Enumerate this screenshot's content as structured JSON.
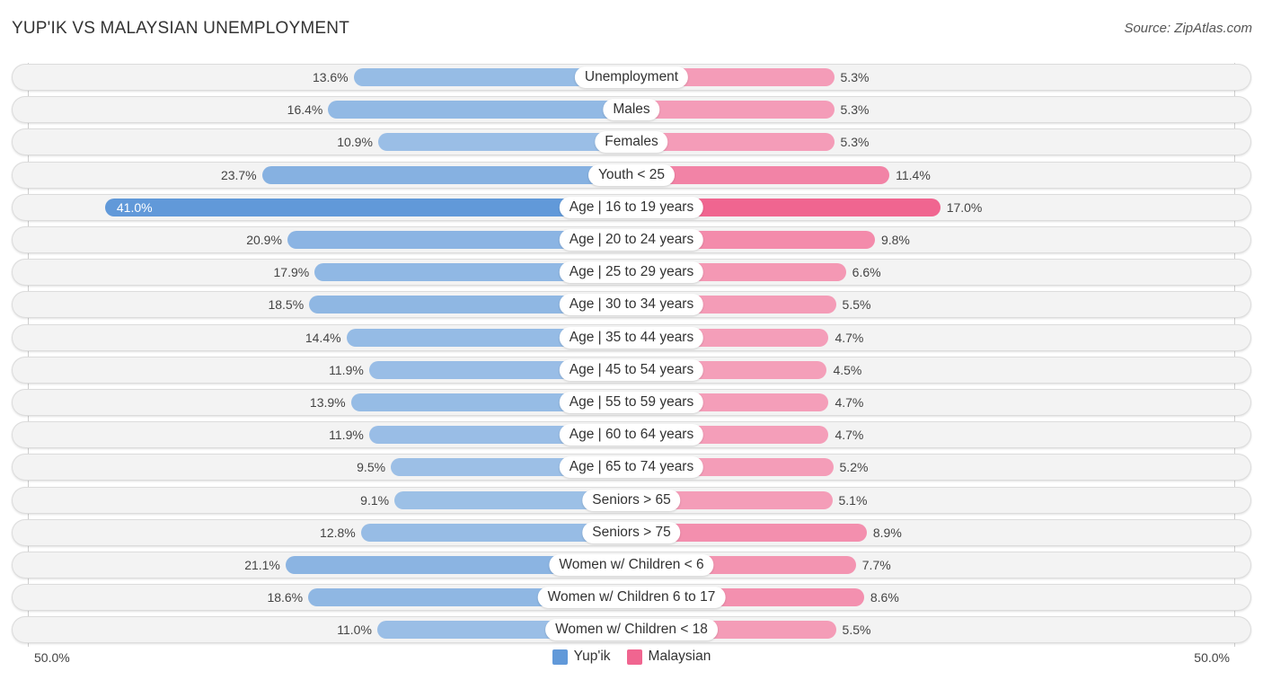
{
  "header": {
    "title": "YUP'IK VS MALAYSIAN UNEMPLOYMENT",
    "source": "Source: ZipAtlas.com"
  },
  "colors": {
    "yupik_strong": "#6199d9",
    "yupik_light": "#a3c4e8",
    "malaysian_strong": "#f06590",
    "malaysian_light": "#f5a8c0"
  },
  "chart_data": {
    "type": "bar",
    "orientation": "horizontal-diverging",
    "title": "YUP'IK VS MALAYSIAN UNEMPLOYMENT",
    "xlabel": "",
    "ylabel": "",
    "axis": {
      "left_label": "50.0%",
      "right_label": "50.0%",
      "range": [
        0,
        50
      ]
    },
    "legend": {
      "placement": "bottom-center",
      "entries": [
        "Yup'ik",
        "Malaysian"
      ]
    },
    "categories": [
      "Unemployment",
      "Males",
      "Females",
      "Youth < 25",
      "Age | 16 to 19 years",
      "Age | 20 to 24 years",
      "Age | 25 to 29 years",
      "Age | 30 to 34 years",
      "Age | 35 to 44 years",
      "Age | 45 to 54 years",
      "Age | 55 to 59 years",
      "Age | 60 to 64 years",
      "Age | 65 to 74 years",
      "Seniors > 65",
      "Seniors > 75",
      "Women w/ Children < 6",
      "Women w/ Children 6 to 17",
      "Women w/ Children < 18"
    ],
    "series": [
      {
        "name": "Yup'ik",
        "side": "left",
        "values": [
          13.6,
          16.4,
          10.9,
          23.7,
          41.0,
          20.9,
          17.9,
          18.5,
          14.4,
          11.9,
          13.9,
          11.9,
          9.5,
          9.1,
          12.8,
          21.1,
          18.6,
          11.0
        ],
        "labels": [
          "13.6%",
          "16.4%",
          "10.9%",
          "23.7%",
          "41.0%",
          "20.9%",
          "17.9%",
          "18.5%",
          "14.4%",
          "11.9%",
          "13.9%",
          "11.9%",
          "9.5%",
          "9.1%",
          "12.8%",
          "21.1%",
          "18.6%",
          "11.0%"
        ]
      },
      {
        "name": "Malaysian",
        "side": "right",
        "values": [
          5.3,
          5.3,
          5.3,
          11.4,
          17.0,
          9.8,
          6.6,
          5.5,
          4.7,
          4.5,
          4.7,
          4.7,
          5.2,
          5.1,
          8.9,
          7.7,
          8.6,
          5.5
        ],
        "labels": [
          "5.3%",
          "5.3%",
          "5.3%",
          "11.4%",
          "17.0%",
          "9.8%",
          "6.6%",
          "5.5%",
          "4.7%",
          "4.5%",
          "4.7%",
          "4.7%",
          "5.2%",
          "5.1%",
          "8.9%",
          "7.7%",
          "8.6%",
          "5.5%"
        ]
      }
    ]
  }
}
